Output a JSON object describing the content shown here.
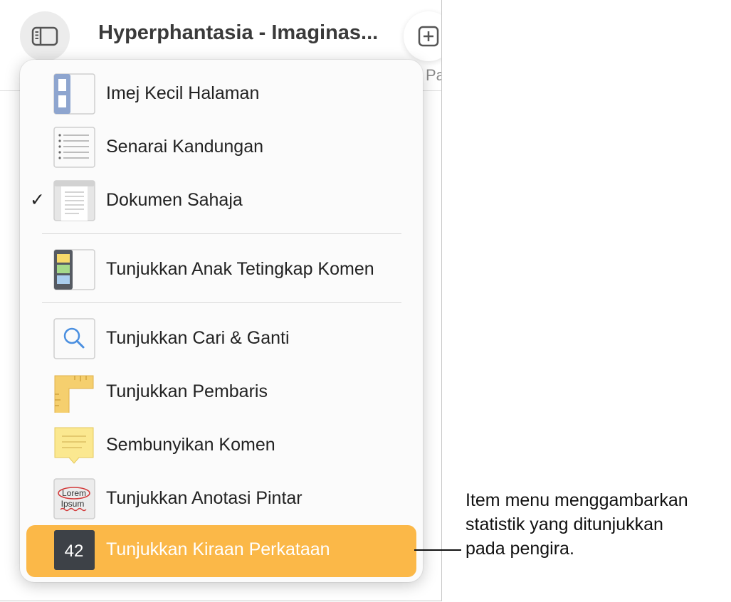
{
  "toolbar": {
    "doc_title": "Hyperphantasia - Imaginas...",
    "sidebar_icon": "sidebar-icon",
    "add_icon": "plus-square-icon",
    "add_label": "Pa"
  },
  "menu": {
    "items": [
      {
        "label": "Imej Kecil Halaman",
        "icon": "page-thumbnails-icon",
        "checked": false
      },
      {
        "label": "Senarai Kandungan",
        "icon": "table-of-contents-icon",
        "checked": false
      },
      {
        "label": "Dokumen Sahaja",
        "icon": "document-only-icon",
        "checked": true,
        "check_mark": "✓"
      },
      {
        "label": "Tunjukkan Anak Tetingkap Komen",
        "icon": "comments-pane-icon",
        "checked": false
      },
      {
        "label": "Tunjukkan Cari & Ganti",
        "icon": "magnifier-icon",
        "checked": false
      },
      {
        "label": "Tunjukkan Pembaris",
        "icon": "ruler-icon",
        "checked": false
      },
      {
        "label": "Sembunyikan Komen",
        "icon": "comment-note-icon",
        "checked": false
      },
      {
        "label": "Tunjukkan Anotasi Pintar",
        "icon": "smart-annotation-icon",
        "checked": false,
        "icon_text": [
          "Lorem",
          "Ipsum"
        ]
      },
      {
        "label": "Tunjukkan Kiraan Perkataan",
        "icon": "word-count-icon",
        "checked": false,
        "highlighted": true,
        "icon_text": "42"
      }
    ]
  },
  "callout": {
    "lines": [
      "Item menu menggambarkan",
      "statistik yang ditunjukkan",
      "pada pengira."
    ]
  },
  "colors": {
    "highlight": "#fbb848",
    "menu_bg": "#fbfbfb",
    "sidebar_button_bg": "#ececec"
  }
}
